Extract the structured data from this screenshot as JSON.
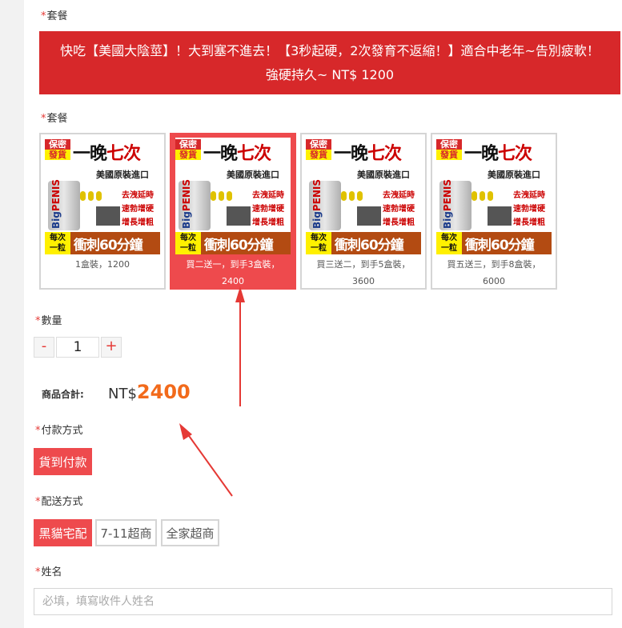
{
  "sections": {
    "banner_label": "套餐",
    "package_label": "套餐",
    "quantity_label": "數量",
    "payment_label": "付款方式",
    "shipping_label": "配送方式",
    "name_label": "姓名",
    "required_mark": "*"
  },
  "banner": {
    "line1": "快吃【美國大陰莖】！大到塞不進去！【3秒起硬，2次發育不返縮！】適合中老年~告別疲軟！",
    "line2": "強硬持久~ NT$ 1200"
  },
  "product_art": {
    "secret_top": "保密",
    "secret_bottom": "發貨",
    "headline_a": "一晚",
    "headline_b": "七次",
    "subtitle": "美國原裝進口",
    "features": [
      "去洩延時",
      "速勃增硬",
      "增長增粗"
    ],
    "per_dose_top": "每次",
    "per_dose_bottom": "一粒",
    "sprint": "衝刺60分鐘",
    "bottle_brand_a": "Big",
    "bottle_brand_b": "PENIS"
  },
  "packages": [
    {
      "line1": "1盒裝，1200",
      "line2": "",
      "selected": false
    },
    {
      "line1": "買二送一，到手3盒裝，",
      "line2": "2400",
      "selected": true
    },
    {
      "line1": "買三送二，到手5盒裝，",
      "line2": "3600",
      "selected": false
    },
    {
      "line1": "買五送三，到手8盒裝，",
      "line2": "6000",
      "selected": false
    }
  ],
  "quantity": {
    "minus": "-",
    "value": "1",
    "plus": "+"
  },
  "total": {
    "label": "商品合計:",
    "currency": "NT$",
    "amount": "2400"
  },
  "payment": {
    "options": [
      {
        "label": "貨到付款",
        "selected": true
      }
    ]
  },
  "shipping": {
    "options": [
      {
        "label": "黑貓宅配",
        "selected": true
      },
      {
        "label": "7-11超商",
        "selected": false
      },
      {
        "label": "全家超商",
        "selected": false
      }
    ]
  },
  "name_field": {
    "placeholder": "必填，填寫收件人姓名",
    "value": ""
  },
  "colors": {
    "accent": "#d7282a",
    "selected": "#ee4a4d",
    "price": "#f26a1b",
    "annotation_arrow": "#e53935"
  }
}
